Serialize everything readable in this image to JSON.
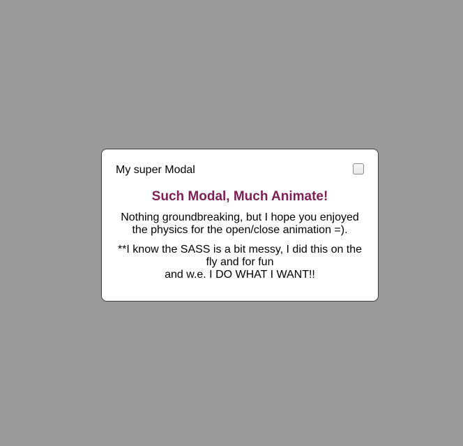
{
  "modal": {
    "title": "My super Modal",
    "close_icon": "checkbox-close-icon",
    "heading": "Such Modal, Much Animate!",
    "paragraph1": {
      "line1": "Nothing groundbreaking, but I hope you enjoyed",
      "line2": "the physics for the open/close animation =)."
    },
    "paragraph2": {
      "line1": "**I know the SASS is a bit messy, I did this on the",
      "line2": "fly and for fun",
      "line3": "and w.e. I DO WHAT I WANT!!"
    }
  },
  "colors": {
    "background": "#9b9b9b",
    "modal_background": "#ffffff",
    "heading": "#7b1f54",
    "text": "#000000"
  }
}
